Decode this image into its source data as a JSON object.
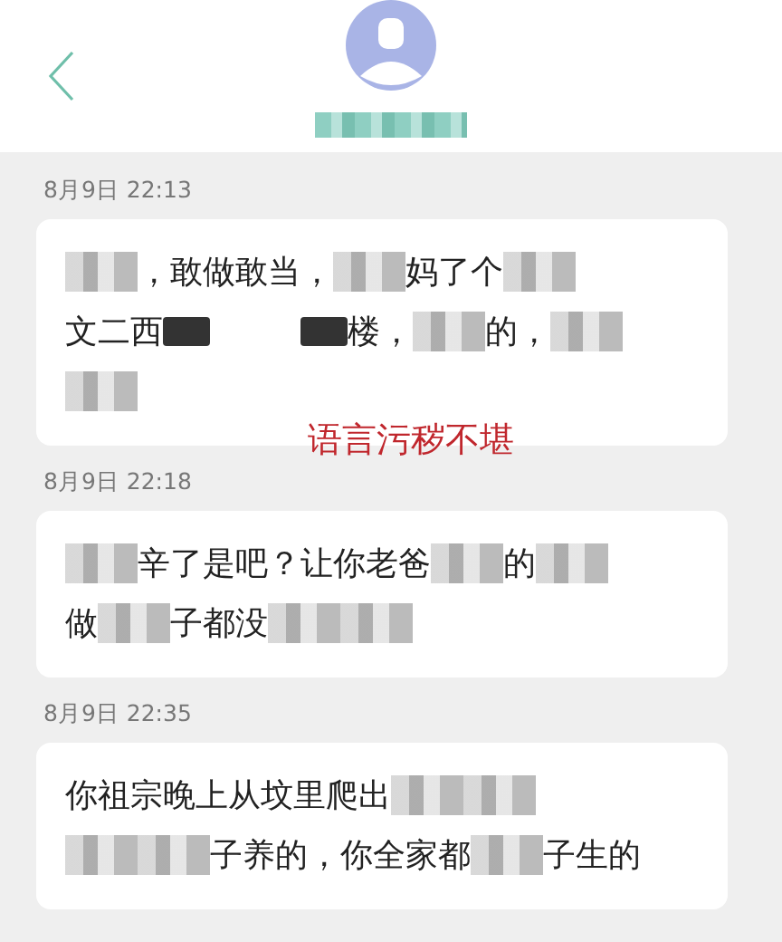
{
  "header": {
    "contact_name": {
      "kind": "blur"
    }
  },
  "overlay_note": "语言污秽不堪",
  "messages": [
    {
      "time": "8月9日  22:13",
      "lines": [
        [
          {
            "kind": "blur"
          },
          {
            "kind": "text",
            "text": "，敢做敢当，"
          },
          {
            "kind": "blur"
          },
          {
            "kind": "text",
            "text": "妈了个"
          },
          {
            "kind": "blur"
          }
        ],
        [
          {
            "kind": "text",
            "text": "文二西"
          },
          {
            "kind": "redact"
          },
          {
            "kind": "gap"
          },
          {
            "kind": "redact"
          },
          {
            "kind": "text",
            "text": "楼，"
          },
          {
            "kind": "blur"
          },
          {
            "kind": "text",
            "text": "的，"
          },
          {
            "kind": "blur"
          }
        ],
        [
          {
            "kind": "blur"
          }
        ]
      ]
    },
    {
      "time": "8月9日  22:18",
      "lines": [
        [
          {
            "kind": "blur"
          },
          {
            "kind": "text",
            "text": "辛了是吧？让你老爸"
          },
          {
            "kind": "blur"
          },
          {
            "kind": "text",
            "text": "的"
          },
          {
            "kind": "blur"
          }
        ],
        [
          {
            "kind": "text",
            "text": "做"
          },
          {
            "kind": "blur"
          },
          {
            "kind": "text",
            "text": "子都没"
          },
          {
            "kind": "blur"
          },
          {
            "kind": "blur"
          }
        ]
      ]
    },
    {
      "time": "8月9日  22:35",
      "lines": [
        [
          {
            "kind": "text",
            "text": "你祖宗晚上从坟里爬出"
          },
          {
            "kind": "blur"
          },
          {
            "kind": "blur"
          }
        ],
        [
          {
            "kind": "blur"
          },
          {
            "kind": "blur"
          },
          {
            "kind": "text",
            "text": "子养的，你全家都"
          },
          {
            "kind": "blur"
          },
          {
            "kind": "text",
            "text": "子生的"
          }
        ]
      ]
    }
  ]
}
